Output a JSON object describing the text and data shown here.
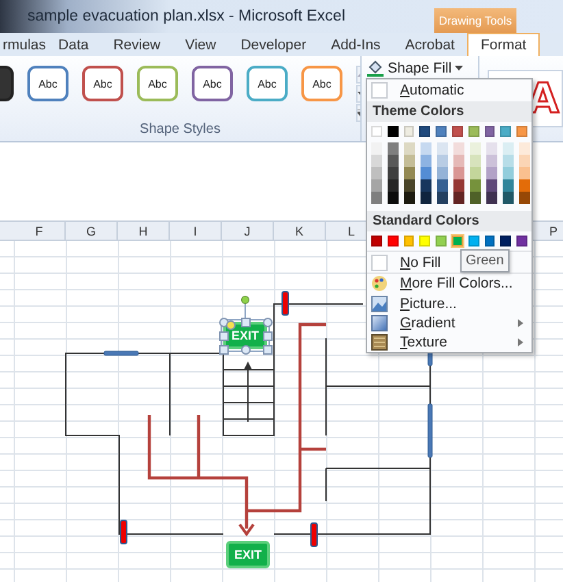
{
  "window": {
    "title": "sample evacuation plan.xlsx  -  Microsoft Excel",
    "context_tab_group": "Drawing Tools"
  },
  "ribbon_tabs": [
    {
      "label": "rmulas",
      "selected": false
    },
    {
      "label": "Data",
      "selected": false
    },
    {
      "label": "Review",
      "selected": false
    },
    {
      "label": "View",
      "selected": false
    },
    {
      "label": "Developer",
      "selected": false
    },
    {
      "label": "Add-Ins",
      "selected": false
    },
    {
      "label": "Acrobat",
      "selected": false
    },
    {
      "label": "Format",
      "selected": true
    }
  ],
  "shape_styles": {
    "label": "Shape Styles",
    "presets": [
      {
        "color": "#222222"
      },
      {
        "label": "Abc",
        "color": "#4f81bd"
      },
      {
        "label": "Abc",
        "color": "#c0504d"
      },
      {
        "label": "Abc",
        "color": "#9bbb59"
      },
      {
        "label": "Abc",
        "color": "#8064a2"
      },
      {
        "label": "Abc",
        "color": "#4bacc6"
      },
      {
        "label": "Abc",
        "color": "#f79646"
      }
    ]
  },
  "wordart_preview": "A",
  "shape_fill_menu": {
    "button": "Shape Fill",
    "automatic": "Automatic",
    "theme_heading": "Theme Colors",
    "theme_colors": [
      {
        "color": "#ffffff",
        "shades": [
          {
            "color": "#f2f2f2"
          },
          {
            "color": "#d8d8d8"
          },
          {
            "color": "#bfbfbf"
          },
          {
            "color": "#a5a5a5"
          },
          {
            "color": "#7f7f7f"
          }
        ]
      },
      {
        "color": "#000000",
        "shades": [
          {
            "color": "#7f7f7f"
          },
          {
            "color": "#595959"
          },
          {
            "color": "#3f3f3f"
          },
          {
            "color": "#262626"
          },
          {
            "color": "#0c0c0c"
          }
        ]
      },
      {
        "color": "#eeece1",
        "shades": [
          {
            "color": "#ddd9c3"
          },
          {
            "color": "#c4bd97"
          },
          {
            "color": "#938953"
          },
          {
            "color": "#494429"
          },
          {
            "color": "#1d1b10"
          }
        ]
      },
      {
        "color": "#1f497d",
        "shades": [
          {
            "color": "#c6d9f0"
          },
          {
            "color": "#8db3e2"
          },
          {
            "color": "#548dd4"
          },
          {
            "color": "#17365d"
          },
          {
            "color": "#0f243e"
          }
        ]
      },
      {
        "color": "#4f81bd",
        "shades": [
          {
            "color": "#dbe5f1"
          },
          {
            "color": "#b8cce4"
          },
          {
            "color": "#95b3d7"
          },
          {
            "color": "#366092"
          },
          {
            "color": "#244061"
          }
        ]
      },
      {
        "color": "#c0504d",
        "shades": [
          {
            "color": "#f2dcdb"
          },
          {
            "color": "#e5b9b7"
          },
          {
            "color": "#d99694"
          },
          {
            "color": "#953734"
          },
          {
            "color": "#632423"
          }
        ]
      },
      {
        "color": "#9bbb59",
        "shades": [
          {
            "color": "#ebf1dd"
          },
          {
            "color": "#d7e3bc"
          },
          {
            "color": "#c3d69b"
          },
          {
            "color": "#76923c"
          },
          {
            "color": "#4f6128"
          }
        ]
      },
      {
        "color": "#8064a2",
        "shades": [
          {
            "color": "#e5e0ec"
          },
          {
            "color": "#ccc1d9"
          },
          {
            "color": "#b2a2c7"
          },
          {
            "color": "#5f497a"
          },
          {
            "color": "#3f3151"
          }
        ]
      },
      {
        "color": "#4bacc6",
        "shades": [
          {
            "color": "#dbeef3"
          },
          {
            "color": "#b7dde8"
          },
          {
            "color": "#92cddc"
          },
          {
            "color": "#31859b"
          },
          {
            "color": "#205867"
          }
        ]
      },
      {
        "color": "#f79646",
        "shades": [
          {
            "color": "#fdeada"
          },
          {
            "color": "#fbd5b5"
          },
          {
            "color": "#fac08f"
          },
          {
            "color": "#e36c09"
          },
          {
            "color": "#974806"
          }
        ]
      }
    ],
    "standard_heading": "Standard Colors",
    "standard_colors": [
      {
        "color": "#c00000",
        "selected": false
      },
      {
        "color": "#ff0000",
        "selected": false
      },
      {
        "color": "#ffc000",
        "selected": false
      },
      {
        "color": "#ffff00",
        "selected": false
      },
      {
        "color": "#92d050",
        "selected": false
      },
      {
        "color": "#00b050",
        "selected": true
      },
      {
        "color": "#00b0f0",
        "selected": false
      },
      {
        "color": "#0070c0",
        "selected": false
      },
      {
        "color": "#002060",
        "selected": false
      },
      {
        "color": "#7030a0",
        "selected": false
      }
    ],
    "no_fill": "No Fill",
    "items": [
      {
        "label": "More Fill Colors...",
        "kind": "palette"
      },
      {
        "label": "Picture...",
        "kind": "picture"
      },
      {
        "label": "Gradient",
        "kind": "gradient"
      },
      {
        "label": "Texture",
        "kind": "texture"
      }
    ],
    "tooltip": "Green"
  },
  "sheet": {
    "columns": [
      "F",
      "G",
      "H",
      "I",
      "J",
      "K",
      "L"
    ],
    "columns_right": [
      "P"
    ],
    "exit_signs": [
      {
        "label": "EXIT",
        "selected": true
      },
      {
        "label": "EXIT",
        "selected": false
      }
    ]
  }
}
